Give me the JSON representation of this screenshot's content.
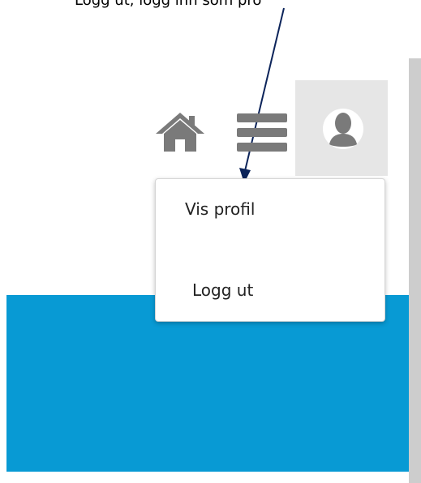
{
  "annotation": {
    "text": "Logg ut, logg inn som pro"
  },
  "header": {
    "home_icon": "home-icon",
    "menu_icon": "menu-icon",
    "user_icon": "user-icon",
    "user_tile_color": "#e6e6e6",
    "icon_color": "#7a7a7a"
  },
  "dropdown": {
    "items": [
      {
        "label": "Vis profil"
      },
      {
        "label": "Logg ut"
      }
    ]
  },
  "colors": {
    "blue_panel": "#089ad4",
    "right_bar": "#cdcdcd",
    "arrow": "#0c245a"
  }
}
